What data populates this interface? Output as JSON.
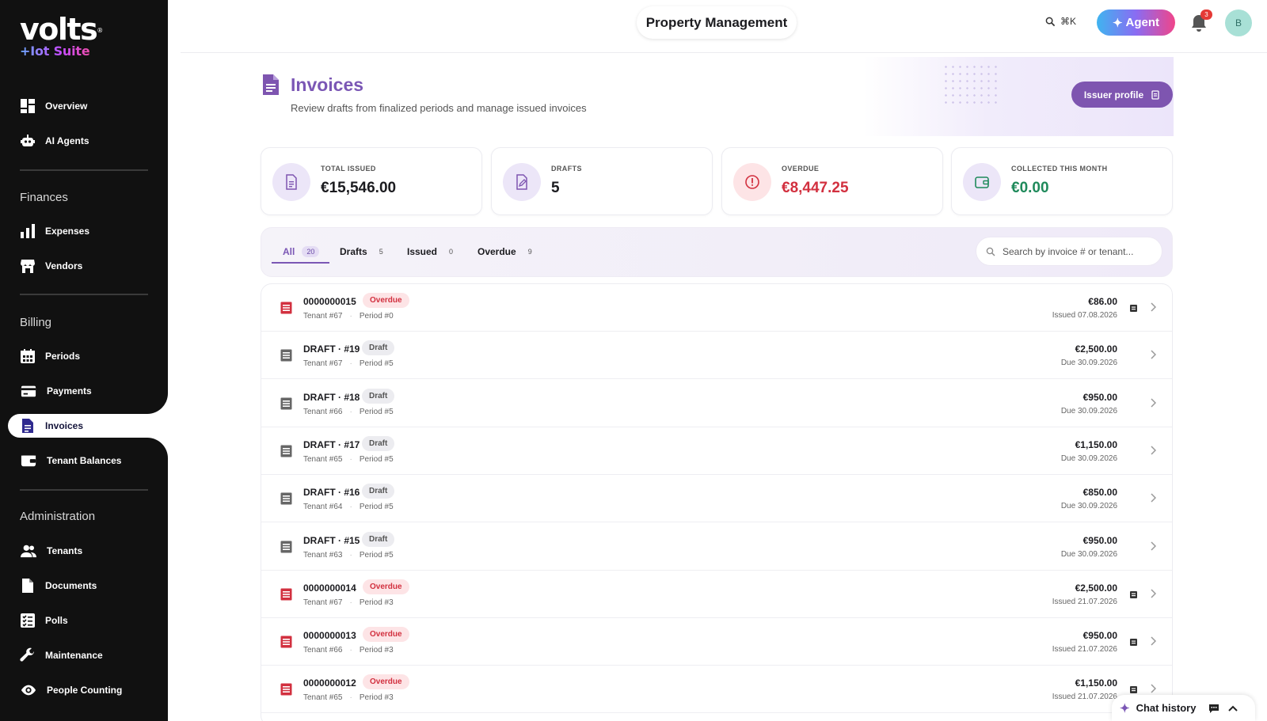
{
  "brand": {
    "name": "volts",
    "tm": "®",
    "suite": "+Iot Suite"
  },
  "sidebar": {
    "items_top": [
      {
        "label": "Overview",
        "icon": "dashboard-icon"
      },
      {
        "label": "AI Agents",
        "icon": "robot-icon"
      }
    ],
    "finances": {
      "title": "Finances",
      "items": [
        {
          "label": "Expenses",
          "icon": "bar-chart-icon"
        },
        {
          "label": "Vendors",
          "icon": "store-icon"
        }
      ]
    },
    "billing": {
      "title": "Billing",
      "items": [
        {
          "label": "Periods",
          "icon": "calendar-icon"
        },
        {
          "label": "Payments",
          "icon": "credit-card-icon"
        },
        {
          "label": "Invoices",
          "icon": "invoice-icon",
          "active": true
        },
        {
          "label": "Tenant Balances",
          "icon": "wallet-icon"
        }
      ]
    },
    "administration": {
      "title": "Administration",
      "items": [
        {
          "label": "Tenants",
          "icon": "people-icon"
        },
        {
          "label": "Documents",
          "icon": "document-icon"
        },
        {
          "label": "Polls",
          "icon": "checklist-icon"
        },
        {
          "label": "Maintenance",
          "icon": "wrench-icon"
        },
        {
          "label": "People Counting",
          "icon": "eye-icon"
        }
      ]
    }
  },
  "topbar": {
    "context": "Property Management",
    "shortcut": "⌘K",
    "agent_label": "Agent",
    "notification_count": "3",
    "avatar_initial": "B"
  },
  "header": {
    "title": "Invoices",
    "subtitle": "Review drafts from finalized periods and manage issued invoices",
    "issuer_button": "Issuer profile"
  },
  "kpis": [
    {
      "label": "TOTAL ISSUED",
      "value": "€15,546.00",
      "color": "#1b1b1f",
      "icon": "document-icon",
      "tint": "#ece6f8"
    },
    {
      "label": "DRAFTS",
      "value": "5",
      "color": "#1b1b1f",
      "icon": "edit-document-icon",
      "tint": "#ece6f8"
    },
    {
      "label": "OVERDUE",
      "value": "€8,447.25",
      "color": "#d2303f",
      "icon": "alert-circle-icon",
      "tint": "#fde4e6"
    },
    {
      "label": "COLLECTED THIS MONTH",
      "value": "€0.00",
      "color": "#1f8a5b",
      "icon": "wallet-icon",
      "tint": "#ece6f8"
    }
  ],
  "tabs": [
    {
      "label": "All",
      "count": "20",
      "active": true
    },
    {
      "label": "Drafts",
      "count": "5"
    },
    {
      "label": "Issued",
      "count": "0"
    },
    {
      "label": "Overdue",
      "count": "9"
    }
  ],
  "search": {
    "placeholder": "Search by invoice # or tenant..."
  },
  "invoices": [
    {
      "number": "0000000015",
      "status": "Overdue",
      "tenant": "Tenant #67",
      "period": "Period #0",
      "amount": "€86.00",
      "date": "Issued 07.08.2026",
      "pdf": true
    },
    {
      "number": "DRAFT · #19",
      "status": "Draft",
      "tenant": "Tenant #67",
      "period": "Period #5",
      "amount": "€2,500.00",
      "date": "Due 30.09.2026",
      "pdf": false
    },
    {
      "number": "DRAFT · #18",
      "status": "Draft",
      "tenant": "Tenant #66",
      "period": "Period #5",
      "amount": "€950.00",
      "date": "Due 30.09.2026",
      "pdf": false
    },
    {
      "number": "DRAFT · #17",
      "status": "Draft",
      "tenant": "Tenant #65",
      "period": "Period #5",
      "amount": "€1,150.00",
      "date": "Due 30.09.2026",
      "pdf": false
    },
    {
      "number": "DRAFT · #16",
      "status": "Draft",
      "tenant": "Tenant #64",
      "period": "Period #5",
      "amount": "€850.00",
      "date": "Due 30.09.2026",
      "pdf": false
    },
    {
      "number": "DRAFT · #15",
      "status": "Draft",
      "tenant": "Tenant #63",
      "period": "Period #5",
      "amount": "€950.00",
      "date": "Due 30.09.2026",
      "pdf": false
    },
    {
      "number": "0000000014",
      "status": "Overdue",
      "tenant": "Tenant #67",
      "period": "Period #3",
      "amount": "€2,500.00",
      "date": "Issued 21.07.2026",
      "pdf": true
    },
    {
      "number": "0000000013",
      "status": "Overdue",
      "tenant": "Tenant #66",
      "period": "Period #3",
      "amount": "€950.00",
      "date": "Issued 21.07.2026",
      "pdf": true
    },
    {
      "number": "0000000012",
      "status": "Overdue",
      "tenant": "Tenant #65",
      "period": "Period #3",
      "amount": "€1,150.00",
      "date": "Issued 21.07.2026",
      "pdf": true
    }
  ],
  "chat": {
    "label": "Chat history"
  },
  "colors": {
    "accent": "#7b57b5",
    "sidebar": "#111111",
    "overdue": "#d2303f",
    "collected": "#1f8a5b"
  }
}
